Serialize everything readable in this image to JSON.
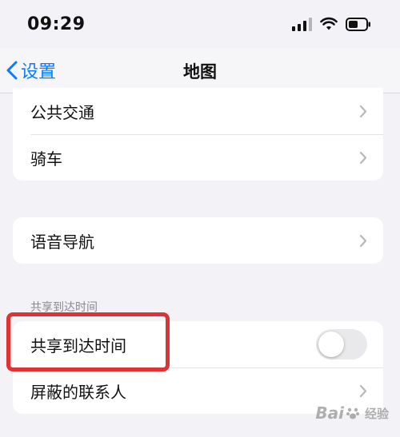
{
  "status_bar": {
    "time": "09:29",
    "icons": [
      "signal-icon",
      "wifi-icon",
      "battery-icon"
    ]
  },
  "nav": {
    "back_label": "设置",
    "title": "地图"
  },
  "transport_group": {
    "items": [
      {
        "label": "公共交通",
        "icon": "chevron-right-icon"
      },
      {
        "label": "骑车",
        "icon": "chevron-right-icon"
      }
    ]
  },
  "voice_group": {
    "items": [
      {
        "label": "语音导航",
        "icon": "chevron-right-icon"
      }
    ]
  },
  "share_section": {
    "header": "共享到达时间",
    "toggle": {
      "label": "共享到达时间",
      "on": false
    },
    "blocked": {
      "label": "屏蔽的联系人",
      "icon": "chevron-right-icon"
    }
  },
  "watermark": {
    "brand": "Bai",
    "sub": "经验"
  },
  "colors": {
    "accent": "#0a7aff",
    "background": "#f2f2f7",
    "highlight": "#e03234",
    "toggle_off": "#e9e9eb"
  }
}
